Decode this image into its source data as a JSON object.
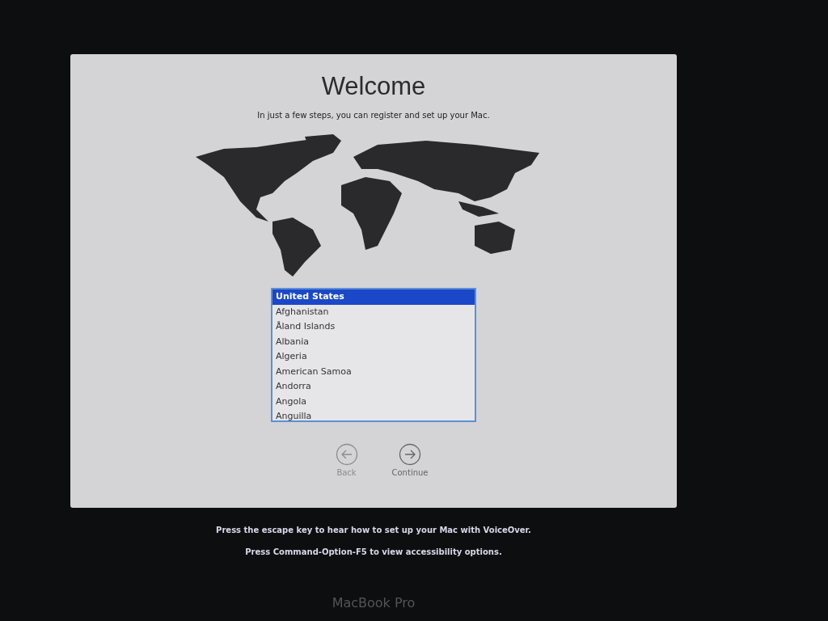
{
  "dialog": {
    "title": "Welcome",
    "subtitle": "In just a few steps, you can register and set up your Mac."
  },
  "country_list": [
    {
      "label": "United States",
      "selected": true
    },
    {
      "label": "Afghanistan",
      "selected": false
    },
    {
      "label": "Åland Islands",
      "selected": false
    },
    {
      "label": "Albania",
      "selected": false
    },
    {
      "label": "Algeria",
      "selected": false
    },
    {
      "label": "American Samoa",
      "selected": false
    },
    {
      "label": "Andorra",
      "selected": false
    },
    {
      "label": "Angola",
      "selected": false
    },
    {
      "label": "Anguilla",
      "selected": false
    }
  ],
  "buttons": [
    {
      "label": "Back",
      "kind": "back",
      "disabled": true
    },
    {
      "label": "Continue",
      "kind": "continue",
      "disabled": false
    }
  ],
  "hints": [
    "Press the escape key to hear how to set up your Mac with VoiceOver.",
    "Press Command-Option-F5 to view accessibility options."
  ],
  "laptop_label": "MacBook Pro"
}
